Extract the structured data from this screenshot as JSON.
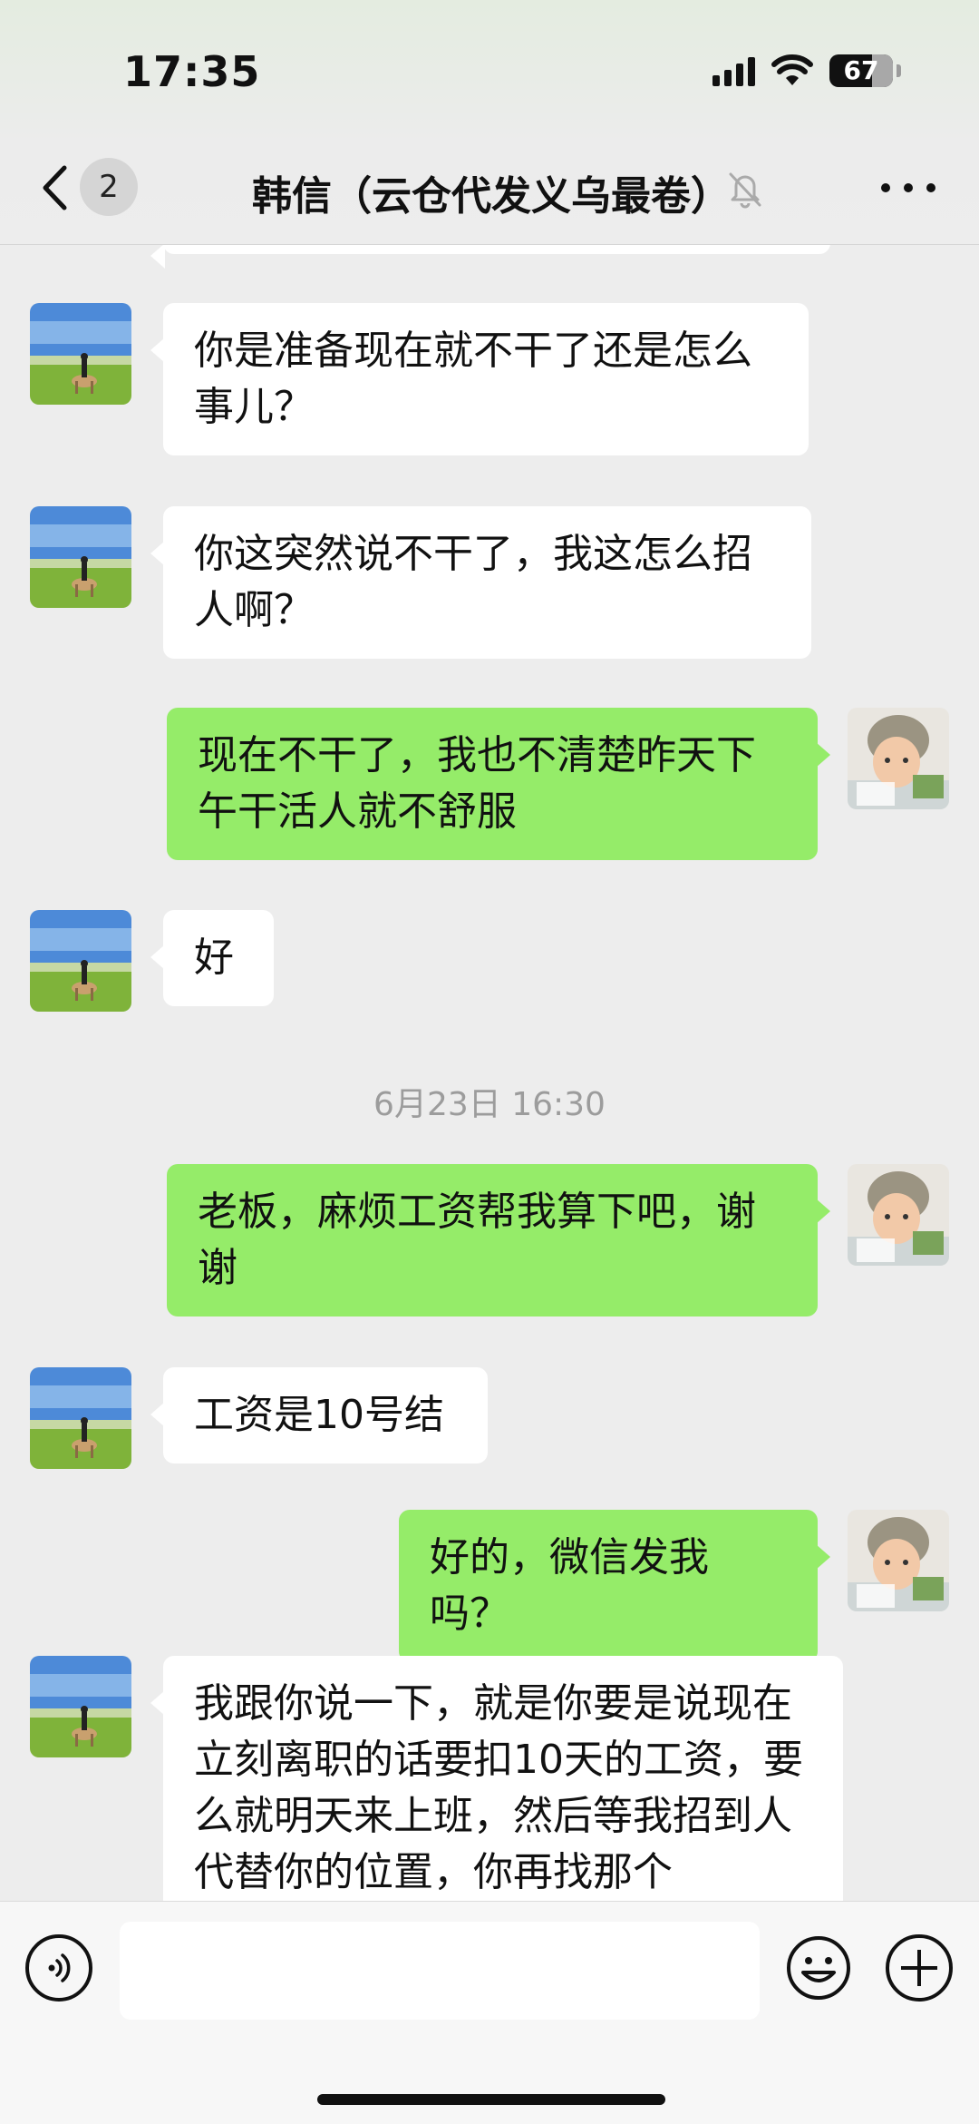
{
  "status_bar": {
    "time": "17:35",
    "battery": "67",
    "icons": [
      "cellular-signal-icon",
      "wifi-icon",
      "battery-icon"
    ]
  },
  "nav": {
    "back_icon": "chevron-left-icon",
    "unread_count": "2",
    "title": "韩信（云仓代发义乌最卷）",
    "mute_icon": "bell-slash-icon",
    "more_icon": "more-dots-icon"
  },
  "chat": {
    "messages": [
      {
        "side": "in",
        "text": "你是准备现在就不干了还是怎么事儿？"
      },
      {
        "side": "in",
        "text": "你这突然说不干了，我这怎么招人啊？"
      },
      {
        "side": "out",
        "text": "现在不干了，我也不清楚昨天下午干活人就不舒服"
      },
      {
        "side": "in",
        "text": "好"
      },
      {
        "side": "out",
        "text": "老板，麻烦工资帮我算下吧，谢谢"
      },
      {
        "side": "in",
        "text": "工资是10号结"
      },
      {
        "side": "out",
        "text": "好的，微信发我吗？"
      },
      {
        "side": "in",
        "text": "我跟你说一下，就是你要是说现在立刻离职的话要扣10天的工资，要么就明天来上班，然后等我招到人代替你的位置，你再找那个"
      }
    ],
    "timestamp": "6月23日 16:30"
  },
  "input_bar": {
    "voice_icon": "voice-icon",
    "input_value": "",
    "emoji_icon": "emoji-icon",
    "plus_icon": "plus-icon"
  },
  "colors": {
    "outgoing_bubble": "#95ec69",
    "incoming_bubble": "#ffffff",
    "background": "#ededed"
  }
}
